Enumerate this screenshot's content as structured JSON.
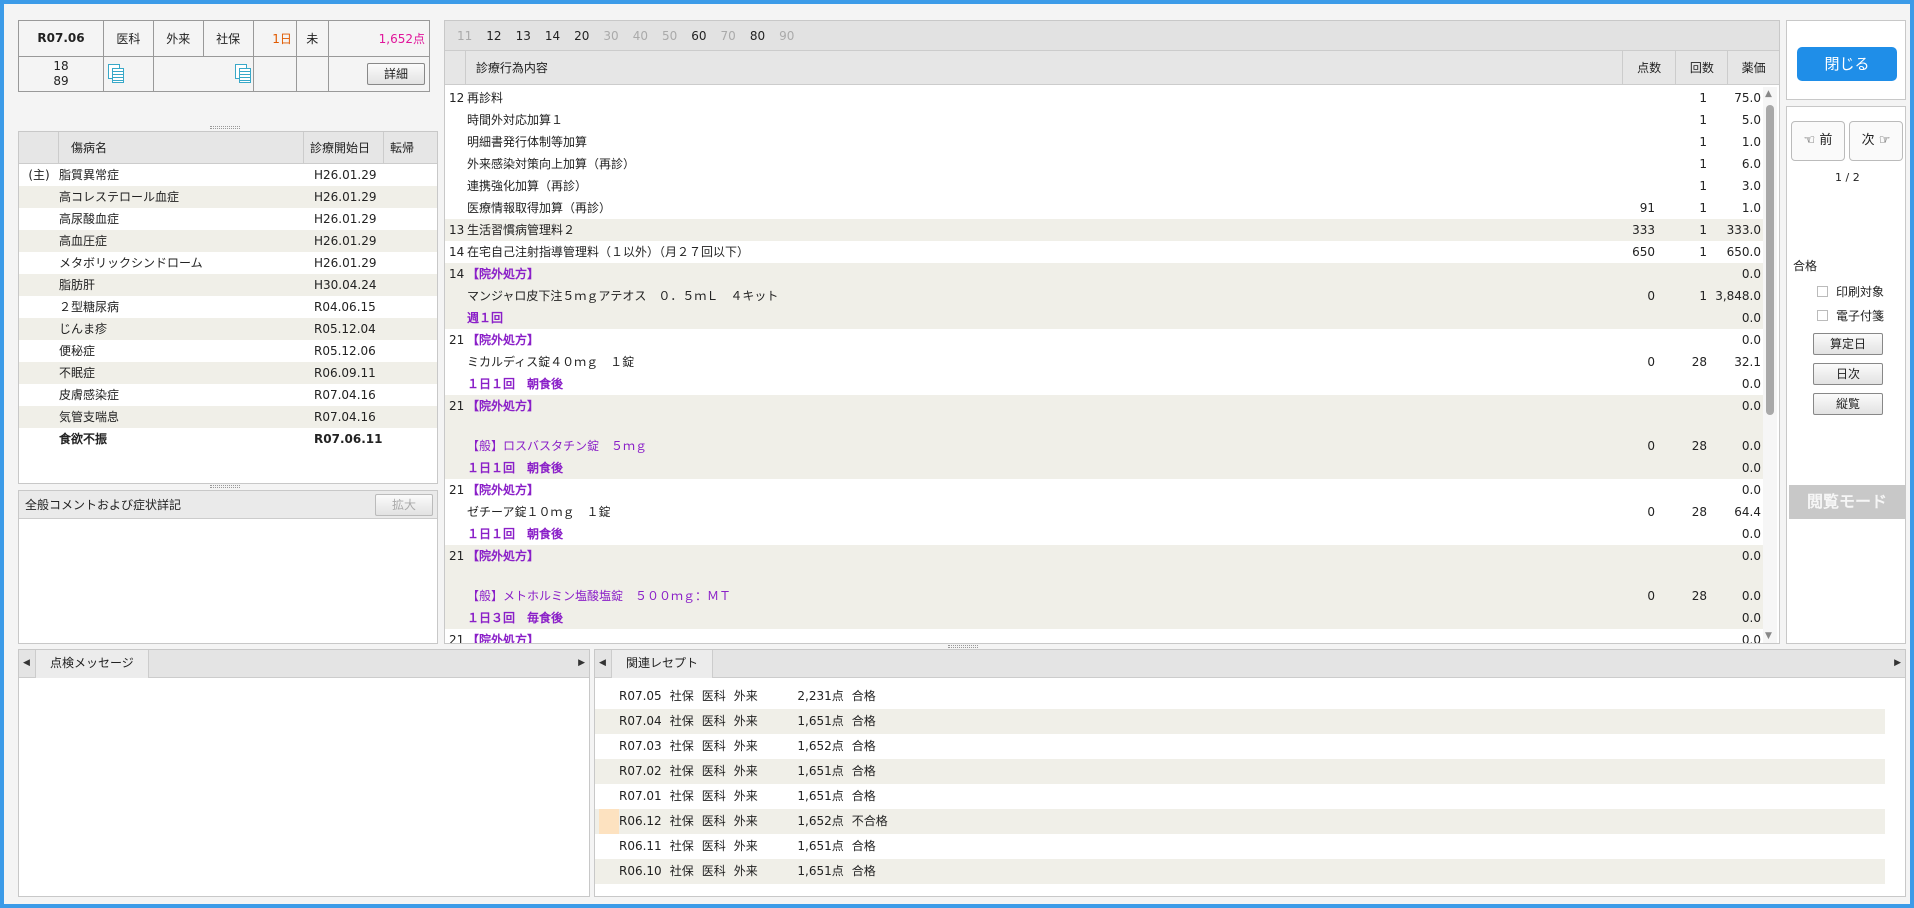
{
  "header": {
    "month": "R07.06",
    "dept": "医科",
    "visit_type": "外来",
    "insurance": "社保",
    "days": "1日",
    "status": "未",
    "points": "1,652点",
    "num_top": "18",
    "num_bottom": "89",
    "detail_button": "詳細"
  },
  "diseases": {
    "columns": [
      "傷病名",
      "診療開始日",
      "転帰"
    ],
    "rows": [
      {
        "mark": "(主)",
        "name": "脂質異常症",
        "date": "H26.01.29",
        "outcome": ""
      },
      {
        "mark": "",
        "name": "高コレステロール血症",
        "date": "H26.01.29",
        "outcome": ""
      },
      {
        "mark": "",
        "name": "高尿酸血症",
        "date": "H26.01.29",
        "outcome": ""
      },
      {
        "mark": "",
        "name": "高血圧症",
        "date": "H26.01.29",
        "outcome": ""
      },
      {
        "mark": "",
        "name": "メタボリックシンドローム",
        "date": "H26.01.29",
        "outcome": ""
      },
      {
        "mark": "",
        "name": "脂肪肝",
        "date": "H30.04.24",
        "outcome": ""
      },
      {
        "mark": "",
        "name": "２型糖尿病",
        "date": "R04.06.15",
        "outcome": ""
      },
      {
        "mark": "",
        "name": "じんま疹",
        "date": "R05.12.04",
        "outcome": ""
      },
      {
        "mark": "",
        "name": "便秘症",
        "date": "R05.12.06",
        "outcome": ""
      },
      {
        "mark": "",
        "name": "不眠症",
        "date": "R06.09.11",
        "outcome": ""
      },
      {
        "mark": "",
        "name": "皮膚感染症",
        "date": "R07.04.16",
        "outcome": ""
      },
      {
        "mark": "",
        "name": "気管支喘息",
        "date": "R07.04.16",
        "outcome": ""
      },
      {
        "mark": "",
        "name": "食欲不振",
        "date": "R07.06.11",
        "outcome": ""
      }
    ]
  },
  "comment": {
    "title": "全般コメントおよび症状詳記",
    "expand_button": "拡大"
  },
  "center": {
    "tabs": [
      {
        "label": "11",
        "dim": true
      },
      {
        "label": "12",
        "dim": false
      },
      {
        "label": "13",
        "dim": false
      },
      {
        "label": "14",
        "dim": false
      },
      {
        "label": "20",
        "dim": false
      },
      {
        "label": "30",
        "dim": true
      },
      {
        "label": "40",
        "dim": true
      },
      {
        "label": "50",
        "dim": true
      },
      {
        "label": "60",
        "dim": false
      },
      {
        "label": "70",
        "dim": true
      },
      {
        "label": "80",
        "dim": false
      },
      {
        "label": "90",
        "dim": true
      }
    ],
    "columns": {
      "proc": "診療行為内容",
      "points": "点数",
      "count": "回数",
      "price": "薬価"
    },
    "rows": [
      {
        "code": "12",
        "name": "再診料",
        "pt": "",
        "ct": "1",
        "pr": "75.0",
        "style": "",
        "alt": false,
        "tall": false
      },
      {
        "code": "",
        "name": "時間外対応加算１",
        "pt": "",
        "ct": "1",
        "pr": "5.0",
        "style": "",
        "alt": false,
        "tall": false
      },
      {
        "code": "",
        "name": "明細書発行体制等加算",
        "pt": "",
        "ct": "1",
        "pr": "1.0",
        "style": "",
        "alt": false,
        "tall": false
      },
      {
        "code": "",
        "name": "外来感染対策向上加算（再診）",
        "pt": "",
        "ct": "1",
        "pr": "6.0",
        "style": "",
        "alt": false,
        "tall": false
      },
      {
        "code": "",
        "name": "連携強化加算（再診）",
        "pt": "",
        "ct": "1",
        "pr": "3.0",
        "style": "",
        "alt": false,
        "tall": false
      },
      {
        "code": "",
        "name": "医療情報取得加算（再診）",
        "pt": "91",
        "ct": "1",
        "pr": "1.0",
        "style": "",
        "alt": false,
        "tall": false
      },
      {
        "code": "13",
        "name": "生活習慣病管理料２",
        "pt": "333",
        "ct": "1",
        "pr": "333.0",
        "style": "",
        "alt": true,
        "tall": false
      },
      {
        "code": "14",
        "name": "在宅自己注射指導管理料（１以外）（月２７回以下）",
        "pt": "650",
        "ct": "1",
        "pr": "650.0",
        "style": "",
        "alt": false,
        "tall": false
      },
      {
        "code": "14",
        "name": "【院外処方】",
        "pt": "",
        "ct": "",
        "pr": "0.0",
        "style": "purb",
        "alt": true,
        "tall": false
      },
      {
        "code": "",
        "name": "マンジャロ皮下注５ｍｇアテオス　０．５ｍＬ　４キット",
        "pt": "0",
        "ct": "1",
        "pr": "3,848.0",
        "style": "",
        "alt": true,
        "tall": false
      },
      {
        "code": "",
        "name": "週１回",
        "pt": "",
        "ct": "",
        "pr": "0.0",
        "style": "purb",
        "alt": true,
        "tall": false
      },
      {
        "code": "21",
        "name": "【院外処方】",
        "pt": "",
        "ct": "",
        "pr": "0.0",
        "style": "purb",
        "alt": false,
        "tall": false
      },
      {
        "code": "",
        "name": "ミカルディス錠４０ｍｇ　１錠",
        "pt": "0",
        "ct": "28",
        "pr": "32.1",
        "style": "",
        "alt": false,
        "tall": false
      },
      {
        "code": "",
        "name": "１日１回　朝食後",
        "pt": "",
        "ct": "",
        "pr": "0.0",
        "style": "purb",
        "alt": false,
        "tall": false
      },
      {
        "code": "21",
        "name": "【院外処方】",
        "pt": "",
        "ct": "",
        "pr": "0.0",
        "style": "purb",
        "alt": true,
        "tall": false
      },
      {
        "code": "",
        "name": "【般】ロスバスタチン錠　５ｍｇ",
        "pt": "0",
        "ct": "28",
        "pr": "0.0",
        "style": "pur",
        "alt": true,
        "tall": true
      },
      {
        "code": "",
        "name": "１日１回　朝食後",
        "pt": "",
        "ct": "",
        "pr": "0.0",
        "style": "purb",
        "alt": true,
        "tall": false
      },
      {
        "code": "21",
        "name": "【院外処方】",
        "pt": "",
        "ct": "",
        "pr": "0.0",
        "style": "purb",
        "alt": false,
        "tall": false
      },
      {
        "code": "",
        "name": "ゼチーア錠１０ｍｇ　１錠",
        "pt": "0",
        "ct": "28",
        "pr": "64.4",
        "style": "",
        "alt": false,
        "tall": false
      },
      {
        "code": "",
        "name": "１日１回　朝食後",
        "pt": "",
        "ct": "",
        "pr": "0.0",
        "style": "purb",
        "alt": false,
        "tall": false
      },
      {
        "code": "21",
        "name": "【院外処方】",
        "pt": "",
        "ct": "",
        "pr": "0.0",
        "style": "purb",
        "alt": true,
        "tall": false
      },
      {
        "code": "",
        "name": "【般】メトホルミン塩酸塩錠　５００ｍｇ：ＭＴ",
        "pt": "0",
        "ct": "28",
        "pr": "0.0",
        "style": "pur",
        "alt": true,
        "tall": true
      },
      {
        "code": "",
        "name": "１日３回　毎食後",
        "pt": "",
        "ct": "",
        "pr": "0.0",
        "style": "purb",
        "alt": true,
        "tall": false
      },
      {
        "code": "21",
        "name": "【院外処方】",
        "pt": "",
        "ct": "",
        "pr": "0.0",
        "style": "purb",
        "alt": false,
        "tall": false
      }
    ]
  },
  "right": {
    "close_button": "閉じる",
    "prev_button": "☜ 前",
    "next_button": "次 ☞",
    "page": "1 / 2",
    "result": "合格",
    "print_target": "印刷対象",
    "e_attach": "電子付箋",
    "calc_day_button": "算定日",
    "daily_button": "日次",
    "vertical_button": "縦覧",
    "mode_label": "閲覧モード"
  },
  "bottom": {
    "check_tab": "点検メッセージ",
    "related_tab": "関連レセプト",
    "related": [
      {
        "month": "R07.05",
        "ins": "社保",
        "dept": "医科",
        "type": "外来",
        "pts": "2,231点",
        "result": "合格",
        "hl": false
      },
      {
        "month": "R07.04",
        "ins": "社保",
        "dept": "医科",
        "type": "外来",
        "pts": "1,651点",
        "result": "合格",
        "hl": false
      },
      {
        "month": "R07.03",
        "ins": "社保",
        "dept": "医科",
        "type": "外来",
        "pts": "1,652点",
        "result": "合格",
        "hl": false
      },
      {
        "month": "R07.02",
        "ins": "社保",
        "dept": "医科",
        "type": "外来",
        "pts": "1,651点",
        "result": "合格",
        "hl": false
      },
      {
        "month": "R07.01",
        "ins": "社保",
        "dept": "医科",
        "type": "外来",
        "pts": "1,651点",
        "result": "合格",
        "hl": false
      },
      {
        "month": "R06.12",
        "ins": "社保",
        "dept": "医科",
        "type": "外来",
        "pts": "1,652点",
        "result": "不合格",
        "hl": true
      },
      {
        "month": "R06.11",
        "ins": "社保",
        "dept": "医科",
        "type": "外来",
        "pts": "1,651点",
        "result": "合格",
        "hl": false
      },
      {
        "month": "R06.10",
        "ins": "社保",
        "dept": "医科",
        "type": "外来",
        "pts": "1,651点",
        "result": "合格",
        "hl": false
      }
    ]
  }
}
